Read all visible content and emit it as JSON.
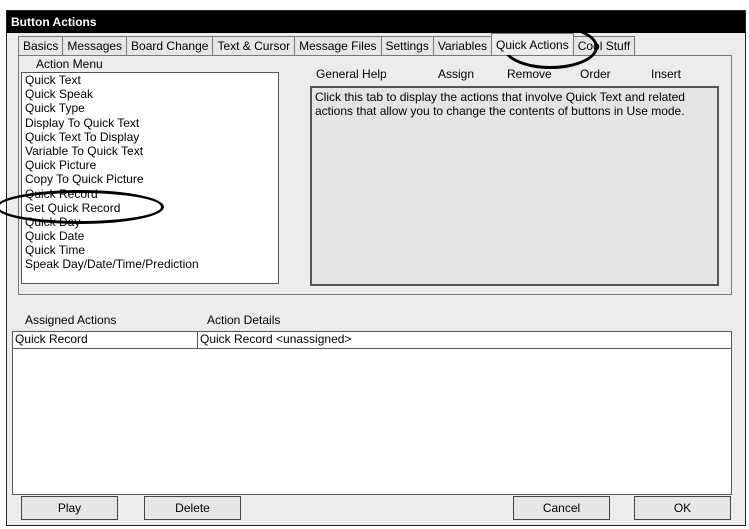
{
  "window": {
    "title": "Button Actions"
  },
  "tabs": [
    {
      "label": "Basics"
    },
    {
      "label": "Messages"
    },
    {
      "label": "Board Change"
    },
    {
      "label": "Text & Cursor"
    },
    {
      "label": "Message Files"
    },
    {
      "label": "Settings"
    },
    {
      "label": "Variables"
    },
    {
      "label": "Quick Actions",
      "active": true
    },
    {
      "label": "Cool Stuff"
    }
  ],
  "action_menu": {
    "label": "Action Menu",
    "items": [
      "Quick Text",
      "Quick Speak",
      "Quick Type",
      "Display To Quick Text",
      "Quick Text To Display",
      "Variable To Quick Text",
      "Quick Picture",
      "Copy To Quick Picture",
      "Quick Record",
      "Get Quick Record",
      "Quick Day",
      "Quick Date",
      "Quick Time",
      "Speak Day/Date/Time/Prediction"
    ]
  },
  "help_header": {
    "general_help": "General Help",
    "assign": "Assign",
    "remove": "Remove",
    "order": "Order",
    "insert": "Insert"
  },
  "help_text": "Click this tab to display the actions that involve Quick Text and related actions that allow you to change the contents of buttons in Use mode.",
  "assigned": {
    "col_actions": "Assigned Actions",
    "col_details": "Action Details",
    "rows": [
      {
        "action": "Quick Record",
        "details": "Quick Record <unassigned>"
      }
    ]
  },
  "buttons": {
    "play": "Play",
    "delete": "Delete",
    "cancel": "Cancel",
    "ok": "OK"
  },
  "icons": {
    "scroll_up": "scroll-up-arrow-icon",
    "scroll_down": "scroll-down-arrow-icon"
  },
  "annotations": {
    "ovals": [
      "quick-actions-tab-highlight",
      "quick-record-item-highlight"
    ]
  }
}
